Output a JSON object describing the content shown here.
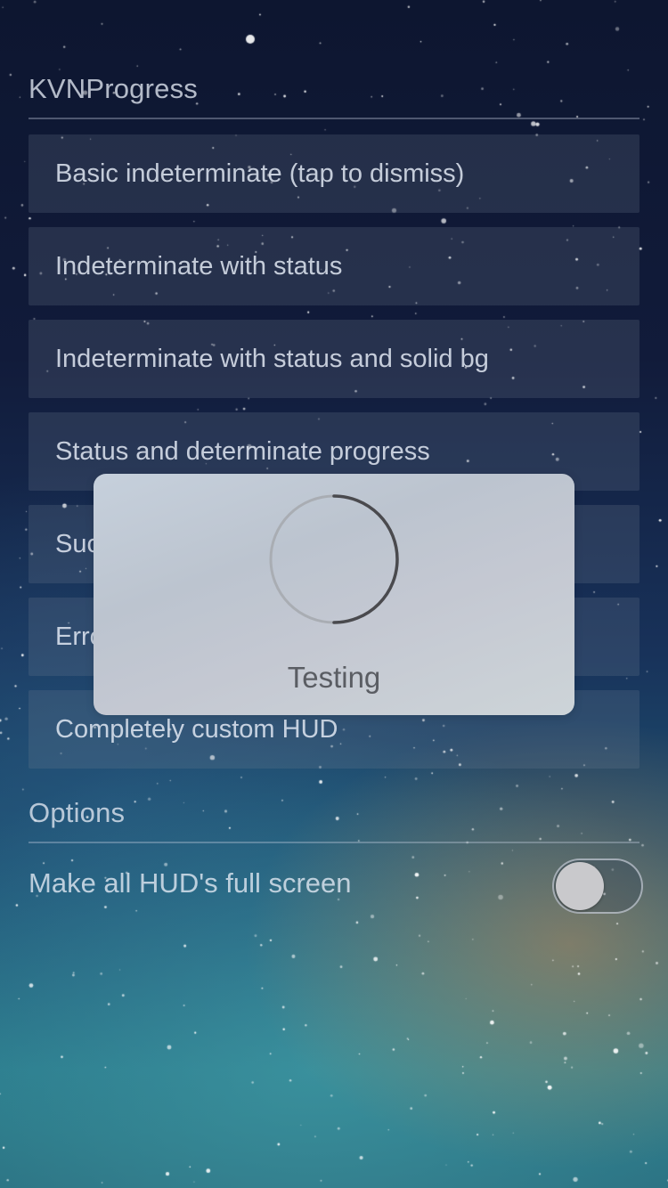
{
  "header": {
    "title": "KVNProgress"
  },
  "menu": {
    "items": [
      {
        "label": "Basic indeterminate (tap to dismiss)"
      },
      {
        "label": "Indeterminate with status"
      },
      {
        "label": "Indeterminate with status and solid bg"
      },
      {
        "label": "Status and determinate progress"
      },
      {
        "label": "Success"
      },
      {
        "label": "Error"
      },
      {
        "label": "Completely custom HUD"
      }
    ]
  },
  "options": {
    "title": "Options",
    "fullscreen_label": "Make all HUD's full screen",
    "fullscreen_on": false
  },
  "hud": {
    "status": "Testing",
    "spinner_icon": "circular-progress-icon"
  },
  "colors": {
    "hud_background": "#c4cad4",
    "spinner_dark": "#4a4a4e",
    "spinner_light": "#a9adb3",
    "toggle_knob": "#c9c9cc"
  }
}
